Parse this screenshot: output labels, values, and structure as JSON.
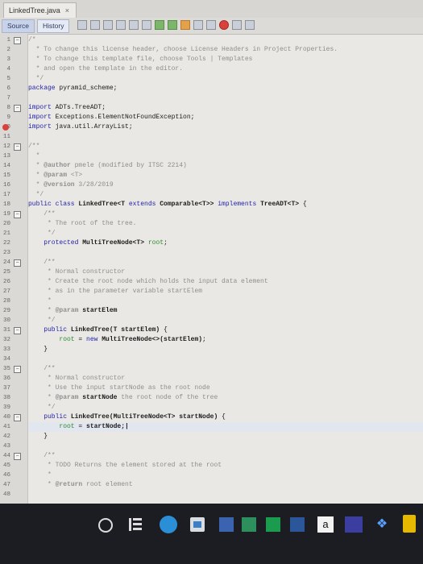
{
  "tab": {
    "title": "LinkedTree.java",
    "close_glyph": "×"
  },
  "toolbar": {
    "source_label": "Source",
    "history_label": "History"
  },
  "code_lines": [
    {
      "num": "1",
      "fold": "minus",
      "parts": [
        {
          "c": "comment",
          "t": "/*"
        }
      ]
    },
    {
      "num": "2",
      "parts": [
        {
          "c": "comment",
          "t": "  * To change this license header, choose License Headers in Project Properties."
        }
      ]
    },
    {
      "num": "3",
      "parts": [
        {
          "c": "comment",
          "t": "  * To change this template file, choose Tools | Templates"
        }
      ]
    },
    {
      "num": "4",
      "parts": [
        {
          "c": "comment",
          "t": "  * and open the template in the editor."
        }
      ]
    },
    {
      "num": "5",
      "parts": [
        {
          "c": "comment",
          "t": "  */"
        }
      ]
    },
    {
      "num": "6",
      "parts": [
        {
          "c": "kw",
          "t": "package"
        },
        {
          "c": "",
          "t": " pyramid_scheme;"
        }
      ]
    },
    {
      "num": "7",
      "parts": []
    },
    {
      "num": "8",
      "fold": "minus",
      "parts": [
        {
          "c": "kw",
          "t": "import"
        },
        {
          "c": "",
          "t": " ADTs.TreeADT;"
        }
      ]
    },
    {
      "num": "9",
      "parts": [
        {
          "c": "kw",
          "t": "import"
        },
        {
          "c": "",
          "t": " Exceptions.ElementNotFoundException;"
        }
      ]
    },
    {
      "num": "10",
      "err": true,
      "parts": [
        {
          "c": "kw",
          "t": "import"
        },
        {
          "c": "",
          "t": " java.util.ArrayList;"
        }
      ]
    },
    {
      "num": "11",
      "parts": []
    },
    {
      "num": "12",
      "fold": "minus",
      "parts": [
        {
          "c": "comment",
          "t": "/**"
        }
      ]
    },
    {
      "num": "13",
      "parts": [
        {
          "c": "comment",
          "t": "  *"
        }
      ]
    },
    {
      "num": "14",
      "parts": [
        {
          "c": "comment",
          "t": "  * "
        },
        {
          "c": "tag",
          "t": "@author"
        },
        {
          "c": "comment",
          "t": " pmele (modified by ITSC 2214)"
        }
      ]
    },
    {
      "num": "15",
      "parts": [
        {
          "c": "comment",
          "t": "  * "
        },
        {
          "c": "tag",
          "t": "@param"
        },
        {
          "c": "comment",
          "t": " <T>"
        }
      ]
    },
    {
      "num": "16",
      "parts": [
        {
          "c": "comment",
          "t": "  * "
        },
        {
          "c": "tag",
          "t": "@version"
        },
        {
          "c": "comment",
          "t": " 3/28/2019"
        }
      ]
    },
    {
      "num": "17",
      "parts": [
        {
          "c": "comment",
          "t": "  */"
        }
      ]
    },
    {
      "num": "18",
      "parts": [
        {
          "c": "kw",
          "t": "public class"
        },
        {
          "c": "ty",
          "t": " LinkedTree<T "
        },
        {
          "c": "kw",
          "t": "extends"
        },
        {
          "c": "ty",
          "t": " Comparable<T>> "
        },
        {
          "c": "kw",
          "t": "implements"
        },
        {
          "c": "ty",
          "t": " TreeADT<T>"
        },
        {
          "c": "",
          "t": " {"
        }
      ]
    },
    {
      "num": "19",
      "fold": "minus",
      "parts": [
        {
          "c": "comment",
          "t": "    /**"
        }
      ]
    },
    {
      "num": "20",
      "parts": [
        {
          "c": "comment",
          "t": "     * The root of the tree."
        }
      ]
    },
    {
      "num": "21",
      "parts": [
        {
          "c": "comment",
          "t": "     */"
        }
      ]
    },
    {
      "num": "22",
      "parts": [
        {
          "c": "kw",
          "t": "    protected"
        },
        {
          "c": "ty",
          "t": " MultiTreeNode<T>"
        },
        {
          "c": "fld",
          "t": " root"
        },
        {
          "c": "",
          "t": ";"
        }
      ]
    },
    {
      "num": "23",
      "parts": []
    },
    {
      "num": "24",
      "fold": "minus",
      "parts": [
        {
          "c": "comment",
          "t": "    /**"
        }
      ]
    },
    {
      "num": "25",
      "parts": [
        {
          "c": "comment",
          "t": "     * Normal constructor"
        }
      ]
    },
    {
      "num": "26",
      "parts": [
        {
          "c": "comment",
          "t": "     * Create the root node which holds the input data element"
        }
      ]
    },
    {
      "num": "27",
      "parts": [
        {
          "c": "comment",
          "t": "     * as in the parameter variable startElem"
        }
      ]
    },
    {
      "num": "28",
      "parts": [
        {
          "c": "comment",
          "t": "     *"
        }
      ]
    },
    {
      "num": "29",
      "parts": [
        {
          "c": "comment",
          "t": "     * "
        },
        {
          "c": "tag",
          "t": "@param"
        },
        {
          "c": "ty",
          "t": " startElem"
        }
      ]
    },
    {
      "num": "30",
      "parts": [
        {
          "c": "comment",
          "t": "     */"
        }
      ]
    },
    {
      "num": "31",
      "fold": "minus",
      "parts": [
        {
          "c": "kw",
          "t": "    public"
        },
        {
          "c": "ty",
          "t": " LinkedTree(T startElem)"
        },
        {
          "c": "",
          "t": " {"
        }
      ]
    },
    {
      "num": "32",
      "parts": [
        {
          "c": "fld",
          "t": "        root"
        },
        {
          "c": "",
          "t": " = "
        },
        {
          "c": "kw",
          "t": "new"
        },
        {
          "c": "ty",
          "t": " MultiTreeNode<>(startElem)"
        },
        {
          "c": "",
          "t": ";"
        }
      ]
    },
    {
      "num": "33",
      "parts": [
        {
          "c": "",
          "t": "    }"
        }
      ]
    },
    {
      "num": "34",
      "parts": []
    },
    {
      "num": "35",
      "fold": "minus",
      "parts": [
        {
          "c": "comment",
          "t": "    /**"
        }
      ]
    },
    {
      "num": "36",
      "parts": [
        {
          "c": "comment",
          "t": "     * Normal constructor"
        }
      ]
    },
    {
      "num": "37",
      "parts": [
        {
          "c": "comment",
          "t": "     * Use the input startNode as the root node"
        }
      ]
    },
    {
      "num": "38",
      "parts": [
        {
          "c": "comment",
          "t": "     * "
        },
        {
          "c": "tag",
          "t": "@param"
        },
        {
          "c": "ty",
          "t": " startNode"
        },
        {
          "c": "comment",
          "t": " the root node of the tree"
        }
      ]
    },
    {
      "num": "39",
      "parts": [
        {
          "c": "comment",
          "t": "     */"
        }
      ]
    },
    {
      "num": "40",
      "fold": "minus",
      "parts": [
        {
          "c": "kw",
          "t": "    public"
        },
        {
          "c": "ty",
          "t": " LinkedTree(MultiTreeNode<T> startNode)"
        },
        {
          "c": "",
          "t": " {"
        }
      ]
    },
    {
      "num": "41",
      "cursor": true,
      "parts": [
        {
          "c": "fld",
          "t": "        root"
        },
        {
          "c": "",
          "t": " = "
        },
        {
          "c": "ty",
          "t": "startNode;|"
        }
      ]
    },
    {
      "num": "42",
      "parts": [
        {
          "c": "",
          "t": "    }"
        }
      ]
    },
    {
      "num": "43",
      "parts": []
    },
    {
      "num": "44",
      "fold": "minus",
      "parts": [
        {
          "c": "comment",
          "t": "    /**"
        }
      ]
    },
    {
      "num": "45",
      "parts": [
        {
          "c": "comment",
          "t": "     * TODO Returns the element stored at the root"
        }
      ]
    },
    {
      "num": "46",
      "parts": [
        {
          "c": "comment",
          "t": "     *"
        }
      ]
    },
    {
      "num": "47",
      "parts": [
        {
          "c": "comment",
          "t": "     * "
        },
        {
          "c": "tag",
          "t": "@return"
        },
        {
          "c": "comment",
          "t": " root element"
        }
      ]
    },
    {
      "num": "48",
      "parts": []
    }
  ],
  "taskbar": {
    "amazon_label": "a"
  }
}
